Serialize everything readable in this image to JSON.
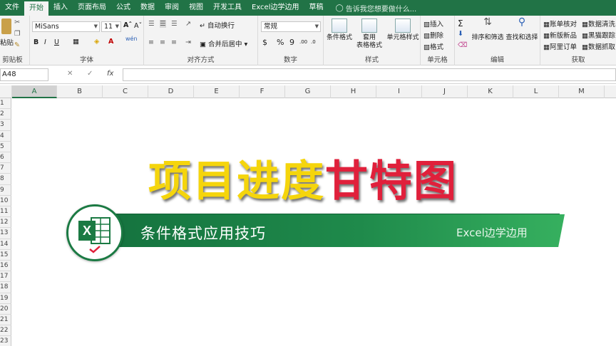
{
  "menubar": {
    "tabs": [
      "文件",
      "开始",
      "插入",
      "页面布局",
      "公式",
      "数据",
      "审阅",
      "视图",
      "开发工具",
      "Excel边学边用",
      "草稿"
    ],
    "active_tab": "开始",
    "tell_me": "告诉我您想要做什么..."
  },
  "ribbon": {
    "clipboard": {
      "paste": "粘贴",
      "label": "剪贴板"
    },
    "font": {
      "name": "MiSans",
      "size": "11",
      "bold": "B",
      "italic": "I",
      "underline": "U",
      "wen": "wén",
      "label": "字体"
    },
    "alignment": {
      "wrap": "自动换行",
      "merge": "合并后居中",
      "label": "对齐方式"
    },
    "number": {
      "format": "常规",
      "currency": "$",
      "percent": "%",
      "comma": "9",
      "inc": ".00",
      "dec": ".0",
      "label": "数字"
    },
    "styles": {
      "conditional": "条件格式",
      "table_format": "套用\n表格格式",
      "cell_style": "单元格样式",
      "label": "样式"
    },
    "cells": {
      "insert": "插入",
      "delete": "删除",
      "format": "格式",
      "label": "单元格"
    },
    "editing": {
      "sort": "排序和筛选",
      "find": "查找和选择",
      "label": "编辑"
    },
    "acquire": {
      "items": [
        "账单核对",
        "数据清洗",
        "新版新品",
        "黑猫跟踪",
        "阿里订单",
        "数据抓取"
      ],
      "label": "获取"
    }
  },
  "formula_bar": {
    "name_box": "A48",
    "fx": "fx",
    "value": ""
  },
  "columns": [
    "A",
    "B",
    "C",
    "D",
    "E",
    "F",
    "G",
    "H",
    "I",
    "J",
    "K",
    "L",
    "M"
  ],
  "rows": [
    "1",
    "2",
    "3",
    "4",
    "5",
    "6",
    "7",
    "8",
    "9",
    "10",
    "11",
    "12",
    "13",
    "14",
    "15",
    "16",
    "17",
    "18",
    "19",
    "20",
    "21",
    "22",
    "23"
  ],
  "banner": {
    "title_part1": "项目进度",
    "title_part2": "甘特图",
    "subtitle": "条件格式应用技巧",
    "brand": "Excel边学边用",
    "logo_letter": "X",
    "colors": {
      "title_yellow": "#f5d50c",
      "title_red": "#e0203b",
      "stripe_green": "#1f8a4b",
      "excel_green": "#217346"
    }
  }
}
